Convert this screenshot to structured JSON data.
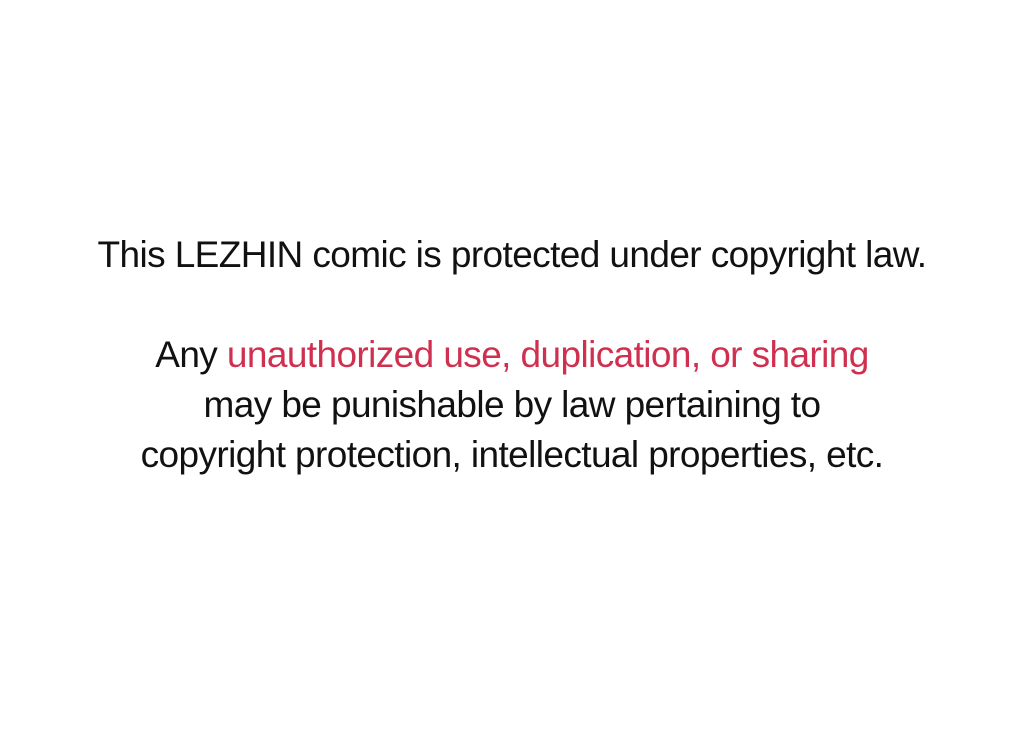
{
  "notice": {
    "heading": "This LEZHIN comic is protected under copyright law.",
    "line2_prefix": "Any ",
    "line2_highlight": "unauthorized use, duplication, or sharing",
    "line3": "may be punishable by law pertaining to",
    "line4": "copyright protection, intellectual properties, etc."
  },
  "colors": {
    "background": "#ffffff",
    "text": "#111111",
    "highlight": "#d0304f"
  }
}
